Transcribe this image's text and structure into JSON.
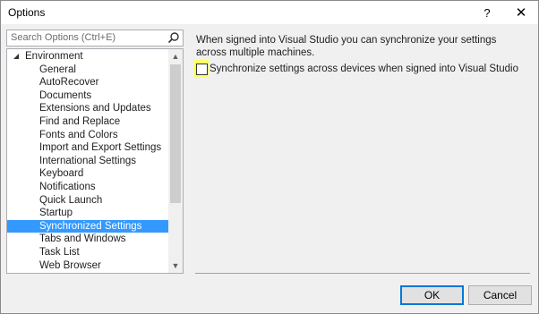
{
  "window": {
    "title": "Options",
    "help_glyph": "?",
    "close_glyph": "✕"
  },
  "search": {
    "placeholder": "Search Options (Ctrl+E)",
    "icon": "search-icon"
  },
  "tree": {
    "parent_label": "Environment",
    "expanded": true,
    "children": [
      "General",
      "AutoRecover",
      "Documents",
      "Extensions and Updates",
      "Find and Replace",
      "Fonts and Colors",
      "Import and Export Settings",
      "International Settings",
      "Keyboard",
      "Notifications",
      "Quick Launch",
      "Startup",
      "Synchronized Settings",
      "Tabs and Windows",
      "Task List",
      "Web Browser"
    ],
    "selected": "Synchronized Settings"
  },
  "content": {
    "description": "When signed into Visual Studio you can synchronize your settings across multiple machines.",
    "checkbox_label": "Synchronize settings across devices when signed into Visual Studio",
    "checkbox_checked": false
  },
  "buttons": {
    "ok": "OK",
    "cancel": "Cancel"
  },
  "colors": {
    "selection": "#3399ff",
    "highlight": "#ffff66"
  }
}
